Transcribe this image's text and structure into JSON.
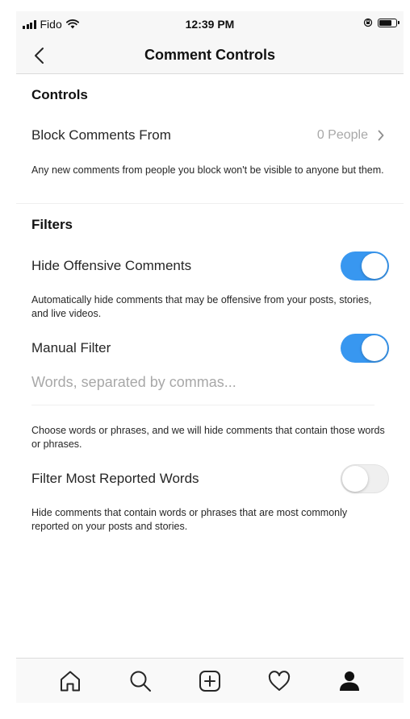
{
  "status_bar": {
    "carrier": "Fido",
    "time": "12:39 PM"
  },
  "header": {
    "title": "Comment Controls"
  },
  "controls": {
    "section_title": "Controls",
    "block_comments": {
      "label": "Block Comments From",
      "value": "0 People"
    },
    "block_description": "Any new comments from people you block won't be visible to anyone but them."
  },
  "filters": {
    "section_title": "Filters",
    "hide_offensive": {
      "label": "Hide Offensive Comments",
      "enabled": true,
      "description": "Automatically hide comments that may be offensive from your posts, stories, and live videos."
    },
    "manual_filter": {
      "label": "Manual Filter",
      "enabled": true,
      "input_value": "",
      "placeholder": "Words, separated by commas...",
      "description": "Choose words or phrases, and we will hide comments that contain those words or phrases."
    },
    "most_reported": {
      "label": "Filter Most Reported Words",
      "enabled": false,
      "description": "Hide comments that contain words or phrases that are most commonly reported on your posts and stories."
    }
  },
  "tab_bar": {
    "icons": [
      "home-icon",
      "search-icon",
      "add-post-icon",
      "heart-icon",
      "profile-icon"
    ],
    "active": "profile-icon"
  },
  "colors": {
    "accent": "#3897f0",
    "text": "#262626",
    "muted": "#a8a8a8",
    "divider": "#efefef"
  }
}
